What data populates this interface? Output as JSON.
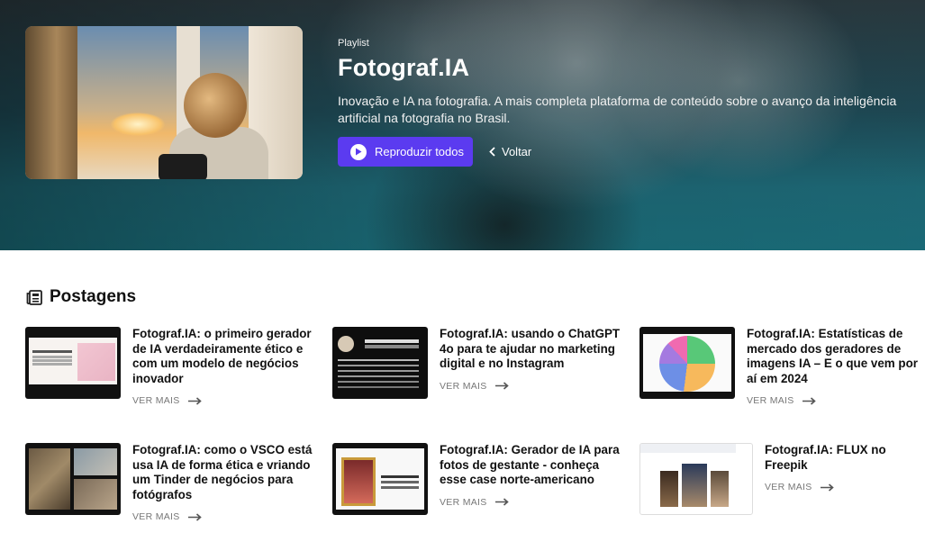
{
  "hero": {
    "label": "Playlist",
    "title": "Fotograf.IA",
    "description": "Inovação e IA na fotografia. A mais completa plataforma de conteúdo sobre o avanço da inteligência artificial na fotografia no Brasil.",
    "play_button": "Reproduzir todos",
    "back_link": "Voltar",
    "accent_color": "#5b3bf0"
  },
  "section": {
    "title": "Postagens",
    "icon": "newspaper-icon"
  },
  "posts": [
    {
      "title": "Fotograf.IA: o primeiro gerador de IA verdadeiramente ético e com um modelo de negócios inovador",
      "more": "VER MAIS"
    },
    {
      "title": "Fotograf.IA: usando o ChatGPT 4o para te ajudar no marketing digital e no Instagram",
      "more": "VER MAIS"
    },
    {
      "title": "Fotograf.IA: Estatísticas de mercado dos geradores de imagens IA – E o que vem por aí em 2024",
      "more": "VER MAIS"
    },
    {
      "title": "Fotograf.IA: como o VSCO está usa IA de forma ética e vriando um Tinder de negócios para fotógrafos",
      "more": "VER MAIS"
    },
    {
      "title": "Fotograf.IA: Gerador de IA para fotos de gestante - conheça esse case norte-americano",
      "more": "VER MAIS"
    },
    {
      "title": "Fotograf.IA: FLUX no Freepik",
      "more": "VER MAIS"
    }
  ]
}
